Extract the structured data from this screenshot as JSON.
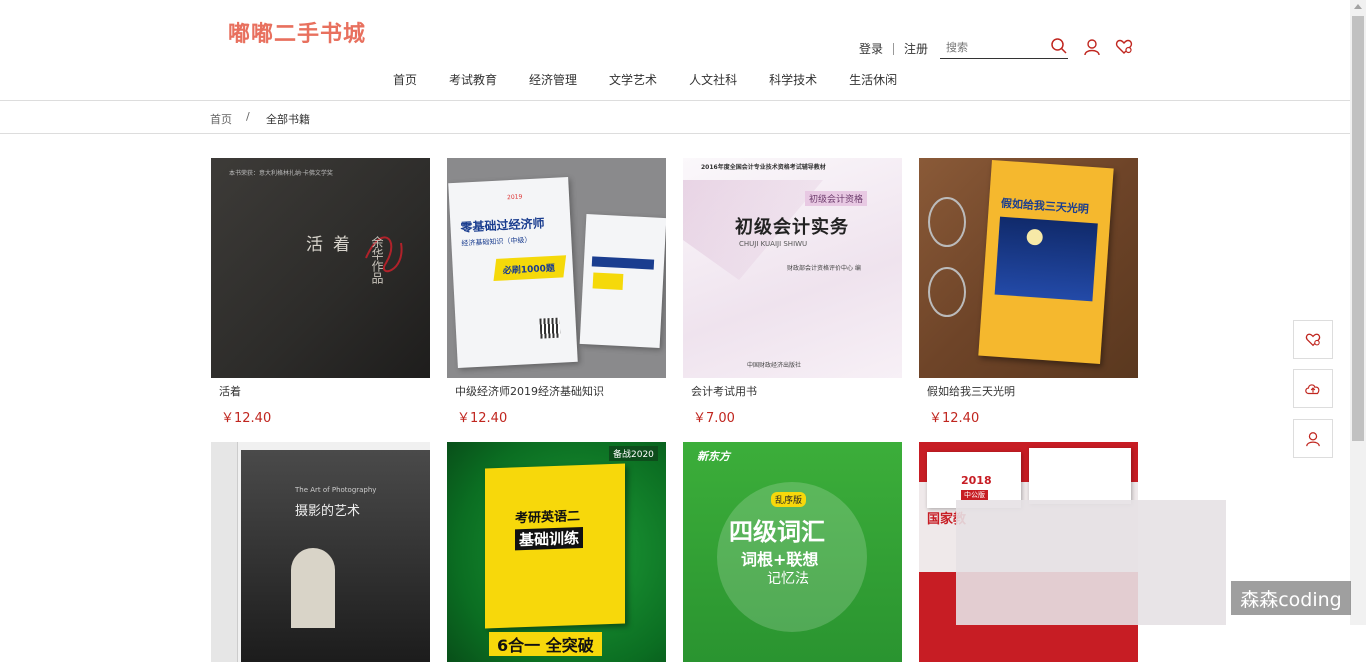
{
  "header": {
    "logo": "嘟嘟二手书城",
    "login": "登录",
    "register": "注册",
    "search_placeholder": "搜索"
  },
  "nav": [
    "首页",
    "考试教育",
    "经济管理",
    "文学艺术",
    "人文社科",
    "科学技术",
    "生活休闲"
  ],
  "breadcrumb": {
    "home": "首页",
    "sep": "/",
    "current": "全部书籍"
  },
  "books": [
    {
      "title": "活着",
      "price": "￥12.40",
      "cover": {
        "title": "活着",
        "author": "余华作品",
        "series": "本书荣获：意大利格林扎纳·卡佛文学奖"
      }
    },
    {
      "title": "中级经济师2019经济基础知识",
      "price": "￥12.40",
      "cover": {
        "title": "零基础过经济师",
        "subtitle": "经济基础知识（中级）",
        "badge": "必刷1000题",
        "year": "2019"
      }
    },
    {
      "title": "会计考试用书",
      "price": "￥7.00",
      "cover": {
        "top": "2016年度全国会计专业技术资格考试辅导教材",
        "tag": "初级会计资格",
        "title": "初级会计实务",
        "pinyin": "CHUJI KUAIJI SHIWU",
        "publisher": "财政部会计资格评价中心 编",
        "press": "中国财政经济出版社"
      }
    },
    {
      "title": "假如给我三天光明",
      "price": "￥12.40",
      "cover": {
        "title": "假如给我三天光明"
      }
    },
    {
      "title": "",
      "price": "",
      "cover": {
        "en": "The Art of Photography",
        "title": "摄影的艺术"
      }
    },
    {
      "title": "",
      "price": "",
      "cover": {
        "badge": "备战2020",
        "title": "考研英语二",
        "subtitle": "基础训练",
        "slogan": "6合一 全突破"
      }
    },
    {
      "title": "",
      "price": "",
      "cover": {
        "brand": "新东方",
        "tag": "乱序版",
        "title": "四级词汇",
        "subtitle": "词根+联想",
        "sub2": "记忆法"
      }
    },
    {
      "title": "",
      "price": "",
      "cover": {
        "year": "2018",
        "tag": "中公版",
        "title": "国家教"
      }
    }
  ],
  "watermark": "森森coding"
}
